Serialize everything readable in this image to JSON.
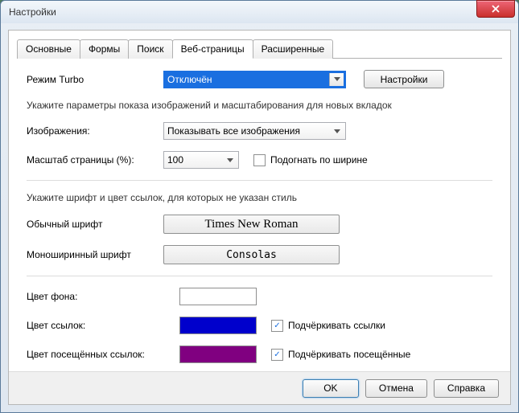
{
  "window": {
    "title": "Настройки"
  },
  "tabs": [
    "Основные",
    "Формы",
    "Поиск",
    "Веб-страницы",
    "Расширенные"
  ],
  "activeTab": 3,
  "turbo": {
    "label": "Режим Turbo",
    "value": "Отключён",
    "button": "Настройки"
  },
  "hint1": "Укажите параметры показа изображений и масштабирования для новых вкладок",
  "images": {
    "label": "Изображения:",
    "value": "Показывать все изображения"
  },
  "scale": {
    "label": "Масштаб страницы (%):",
    "value": "100",
    "fitLabel": "Подогнать по ширине",
    "fitChecked": false
  },
  "hint2": "Укажите шрифт и цвет ссылок, для которых не указан стиль",
  "fonts": {
    "normalLabel": "Обычный шрифт",
    "normalValue": "Times New Roman",
    "monoLabel": "Моноширинный шрифт",
    "monoValue": "Consolas"
  },
  "colors": {
    "bgLabel": "Цвет фона:",
    "bgValue": "#ffffff",
    "linkLabel": "Цвет ссылок:",
    "linkValue": "#0000cc",
    "linkUnderlineLabel": "Подчёркивать ссылки",
    "linkUnderlineChecked": true,
    "visitedLabel": "Цвет посещённых ссылок:",
    "visitedValue": "#800080",
    "visitedUnderlineLabel": "Подчёркивать посещённые",
    "visitedUnderlineChecked": true
  },
  "footer": {
    "ok": "OK",
    "cancel": "Отмена",
    "help": "Справка"
  }
}
